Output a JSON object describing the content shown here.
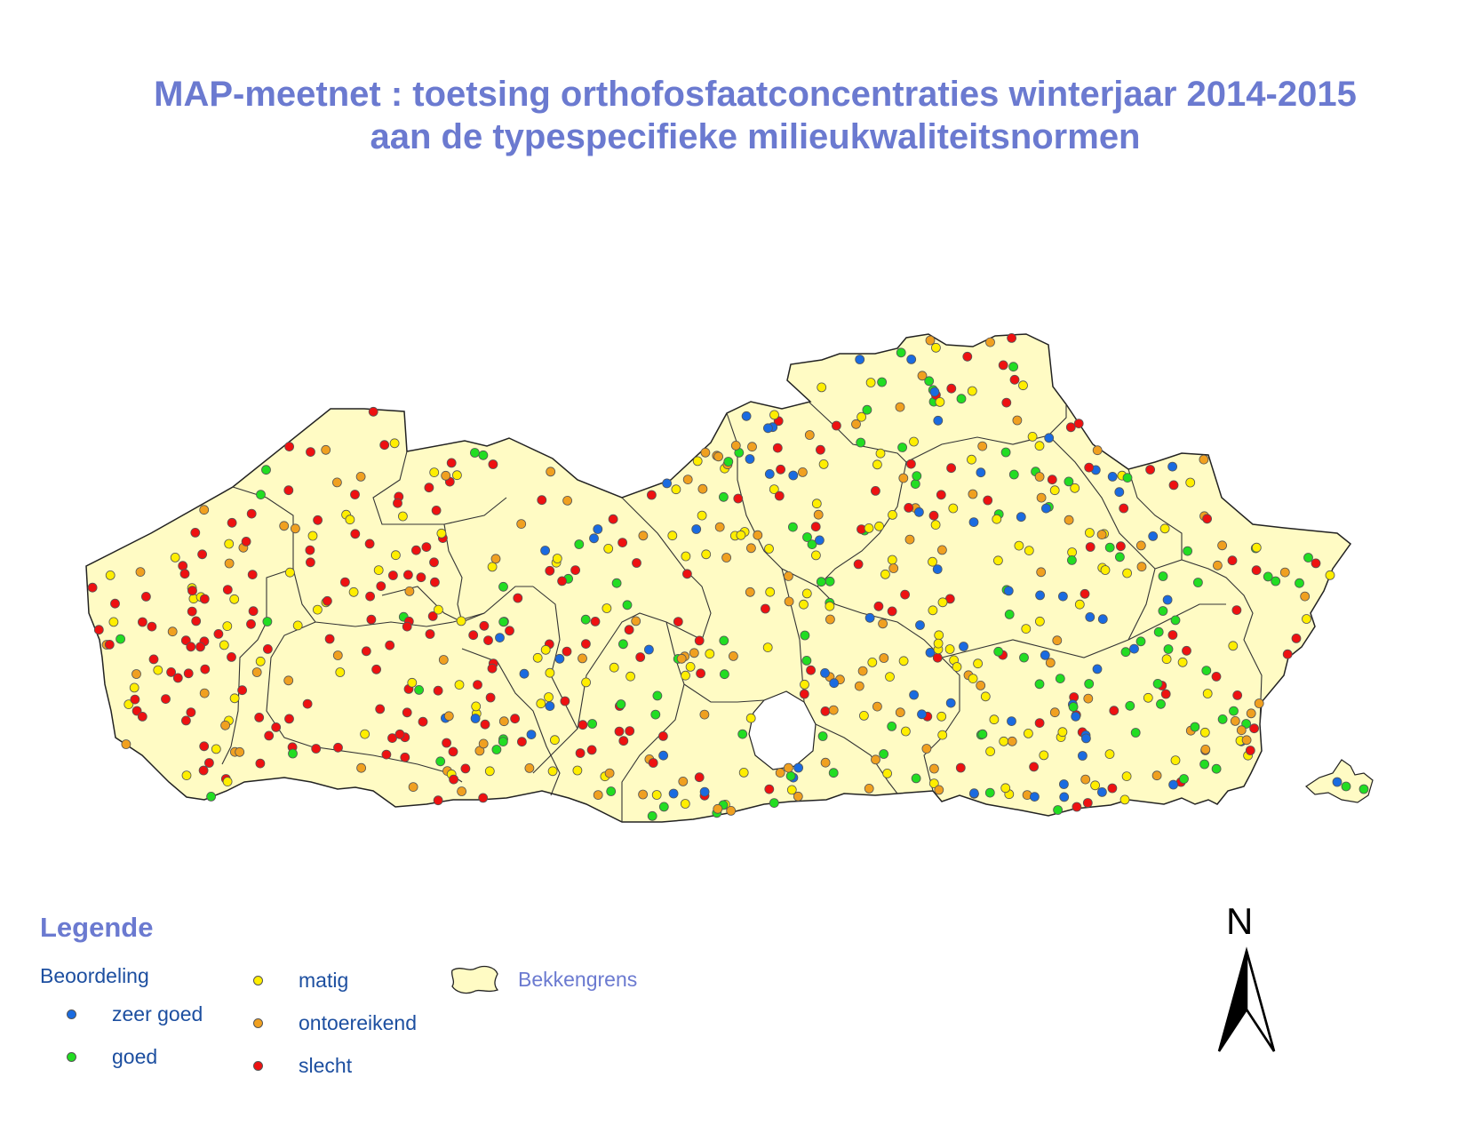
{
  "title": {
    "line1": "MAP-meetnet : toetsing orthofosfaatconcentraties winterjaar 2014-2015",
    "line2": "aan de typespecifieke milieukwaliteitsnormen"
  },
  "legend": {
    "heading": "Legende",
    "subheading": "Beoordeling",
    "items": [
      {
        "key": "zeer_goed",
        "label": "zeer goed",
        "color": "#1a6be0"
      },
      {
        "key": "goed",
        "label": "goed",
        "color": "#22dd22"
      },
      {
        "key": "matig",
        "label": "matig",
        "color": "#ffee00"
      },
      {
        "key": "ontoereikend",
        "label": "ontoereikend",
        "color": "#f0a020"
      },
      {
        "key": "slecht",
        "label": "slecht",
        "color": "#ee1111"
      }
    ],
    "basin_label": "Bekkengrens",
    "basin_fill": "#fffbc4"
  },
  "north_arrow": {
    "letter": "N",
    "icon": "north-arrow-icon"
  },
  "map": {
    "region_fill": "#fffbc4",
    "outline_color": "#222222"
  }
}
